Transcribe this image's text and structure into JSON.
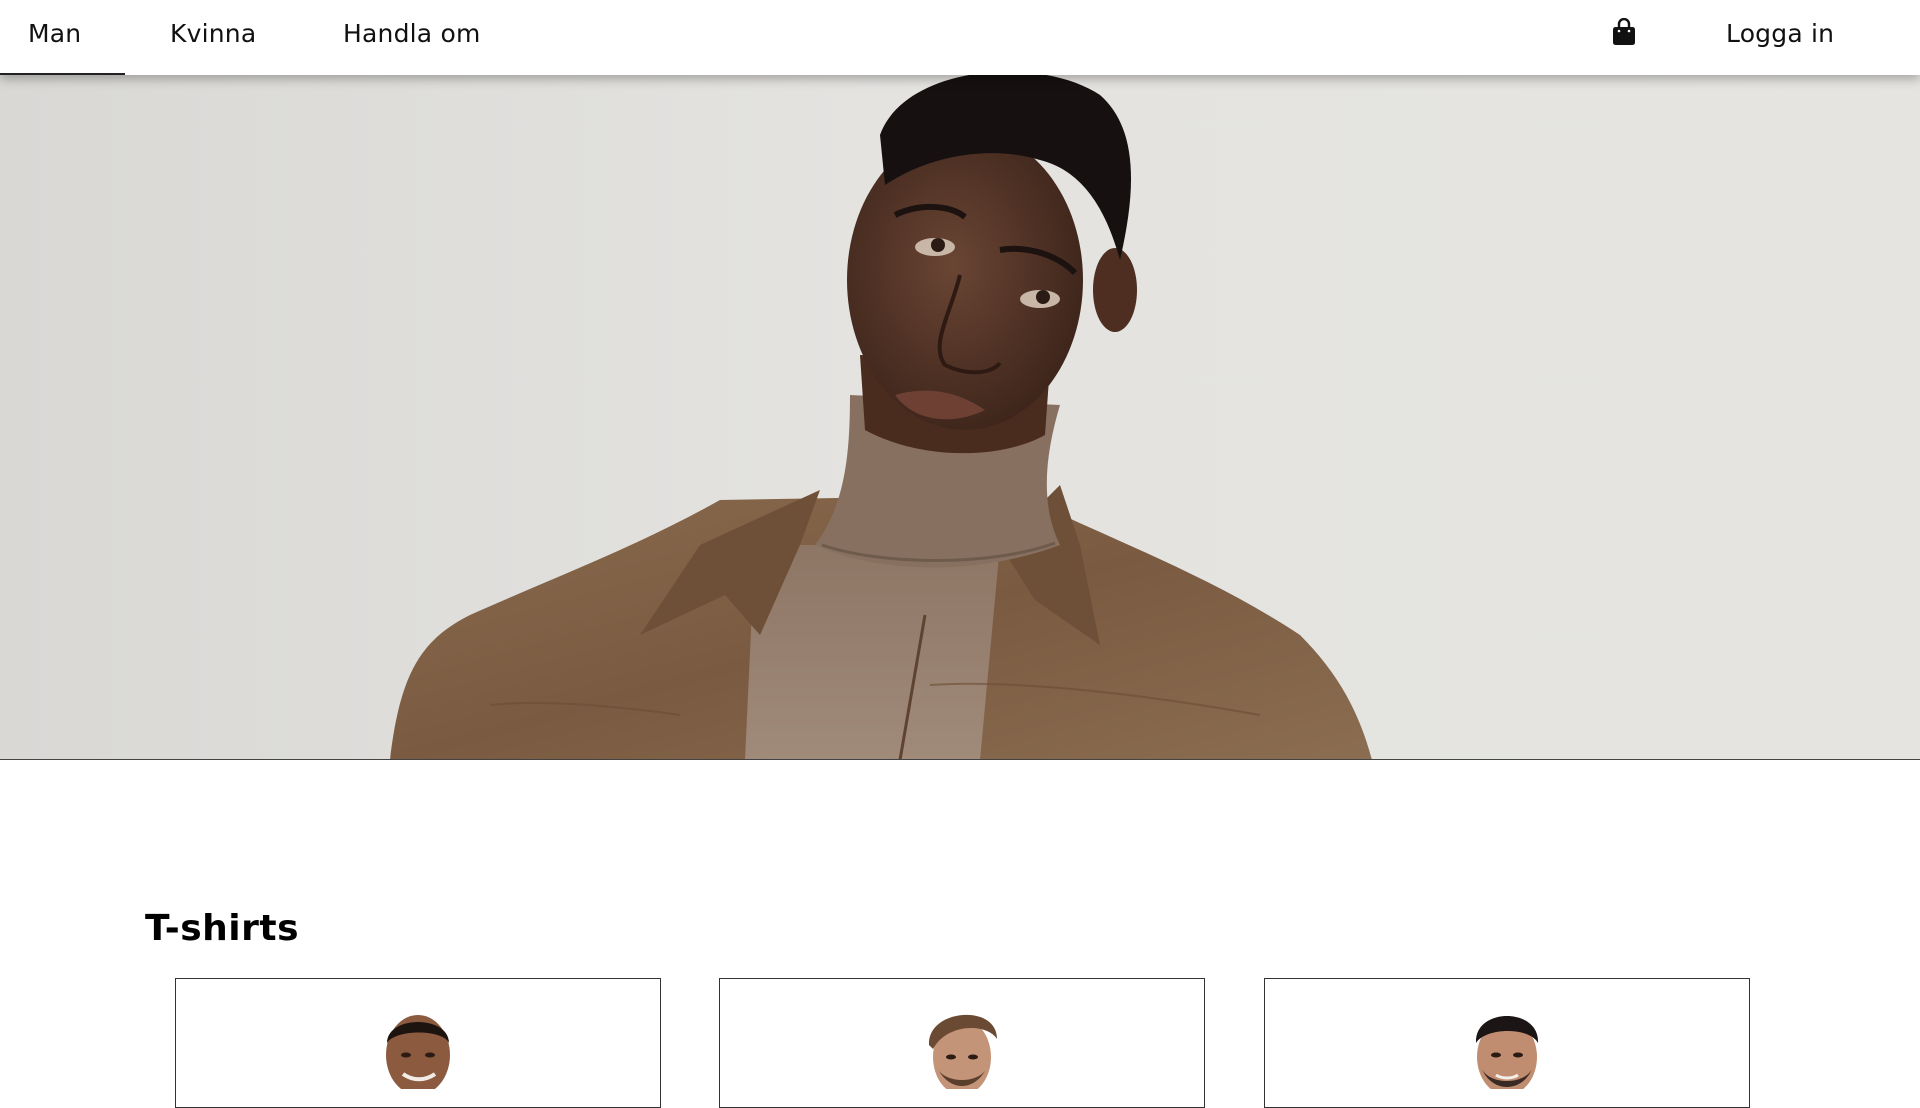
{
  "nav": {
    "left_items": [
      {
        "label": "Man",
        "active": true
      },
      {
        "label": "Kvinna",
        "active": false
      },
      {
        "label": "Handla om",
        "active": false
      }
    ],
    "cart_icon": "shopping-bag-icon",
    "login_label": "Logga in"
  },
  "hero": {
    "image": "model-in-brown-shirt-jacket-and-turtleneck",
    "background_color": "#e3e2df"
  },
  "section": {
    "title": "T-shirts",
    "products": [
      {
        "image": "man-smiling-portrait-1"
      },
      {
        "image": "man-styled-hair-portrait-2"
      },
      {
        "image": "man-beard-portrait-3"
      }
    ]
  },
  "colors": {
    "text": "#111111",
    "nav_underline": "#222222",
    "card_border": "#333333"
  }
}
